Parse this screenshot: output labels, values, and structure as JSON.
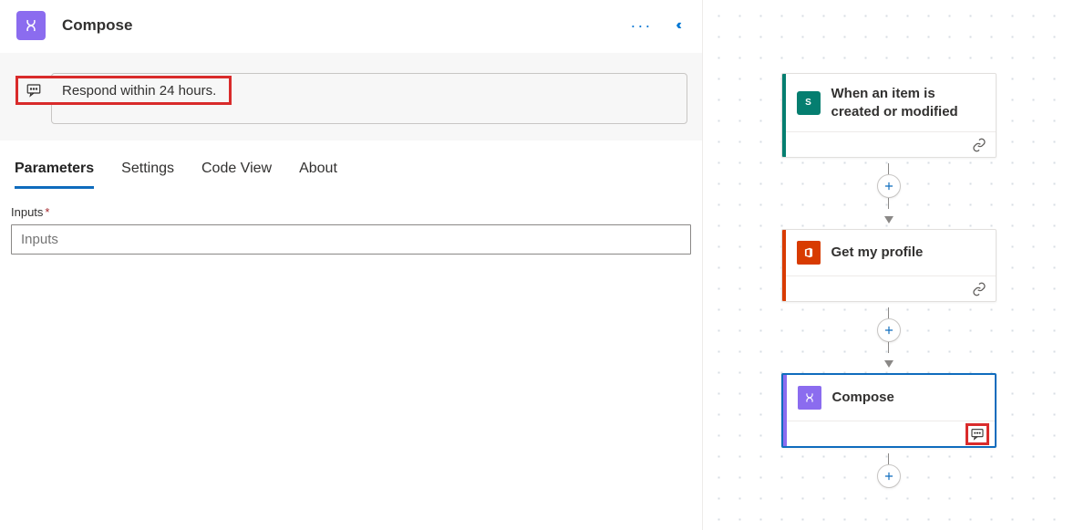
{
  "panel": {
    "title": "Compose",
    "note_text": "Respond within 24 hours."
  },
  "tabs": {
    "parameters": "Parameters",
    "settings": "Settings",
    "code_view": "Code View",
    "about": "About"
  },
  "form": {
    "inputs_label": "Inputs",
    "inputs_placeholder": "Inputs"
  },
  "flow": {
    "card1_title": "When an item is created or modified",
    "card2_title": "Get my profile",
    "card3_title": "Compose"
  }
}
